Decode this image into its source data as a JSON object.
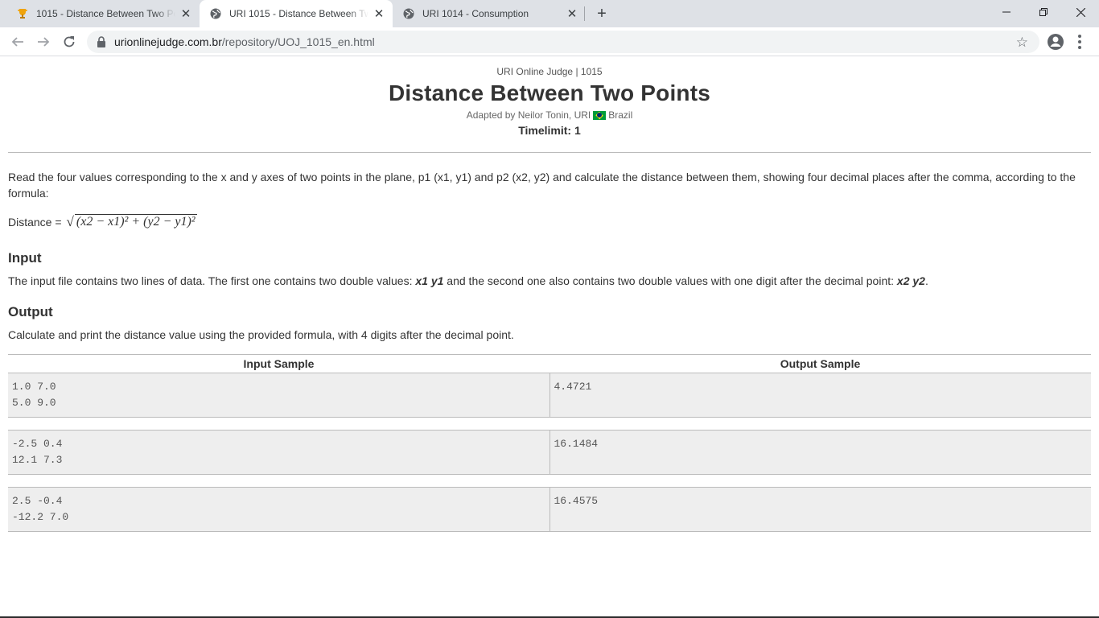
{
  "browser": {
    "tabs": [
      {
        "title": "1015 - Distance Between Two Points",
        "icon": "trophy-icon",
        "active": false
      },
      {
        "title": "URI 1015 - Distance Between Two Points",
        "icon": "globe-icon",
        "active": true
      },
      {
        "title": "URI 1014 - Consumption",
        "icon": "globe-icon",
        "active": false
      }
    ],
    "new_tab_label": "+",
    "url_host": "urionlinejudge.com.br",
    "url_path": "/repository/UOJ_1015_en.html"
  },
  "page": {
    "breadcrumb": "URI Online Judge | 1015",
    "title": "Distance Between Two Points",
    "author_prefix": "Adapted by Neilor Tonin, URI",
    "author_country": "Brazil",
    "timelimit": "Timelimit: 1",
    "description": "Read the four values corresponding to the x and y axes of two points in the plane, p1 (x1, y1) and p2 (x2, y2) and calculate the distance between them, showing four decimal places after the comma, according to the formula:",
    "formula_label": "Distance =",
    "formula_expr": "(x2 − x1)² + (y2 − y1)²",
    "input_heading": "Input",
    "input_text_1": "The input file contains two lines of data. The first one contains two double values: ",
    "input_vars_1": "x1 y1",
    "input_text_2": " and the second one also contains two double values with one digit after the decimal point: ",
    "input_vars_2": "x2 y2",
    "input_text_3": ".",
    "output_heading": "Output",
    "output_text": "Calculate and print the distance value using the provided formula, with 4 digits after the decimal point.",
    "samples_header": {
      "input": "Input Sample",
      "output": "Output Sample"
    },
    "samples": [
      {
        "input": [
          "1.0 7.0",
          "5.0 9.0"
        ],
        "output": [
          "4.4721"
        ]
      },
      {
        "input": [
          "-2.5 0.4",
          "12.1 7.3"
        ],
        "output": [
          "16.1484"
        ]
      },
      {
        "input": [
          "2.5 -0.4",
          "-12.2 7.0"
        ],
        "output": [
          "16.4575"
        ]
      }
    ]
  }
}
